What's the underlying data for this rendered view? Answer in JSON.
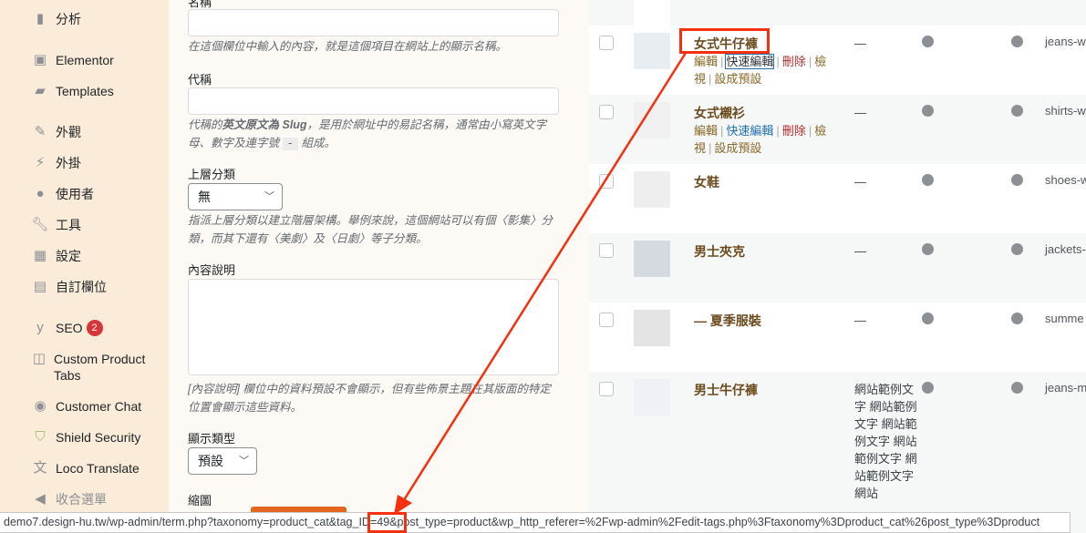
{
  "sidebar": {
    "items": [
      {
        "label": "分析",
        "icon": "chart-bar-icon"
      },
      {
        "label": "Elementor",
        "icon": "elementor-icon"
      },
      {
        "label": "Templates",
        "icon": "folder-icon"
      },
      {
        "label": "外觀",
        "icon": "paintbrush-icon"
      },
      {
        "label": "外掛",
        "icon": "plugin-icon"
      },
      {
        "label": "使用者",
        "icon": "user-icon"
      },
      {
        "label": "工具",
        "icon": "wrench-icon"
      },
      {
        "label": "設定",
        "icon": "settings-icon"
      },
      {
        "label": "自訂欄位",
        "icon": "grid-icon"
      },
      {
        "label": "SEO",
        "icon": "yoast-icon",
        "badge": "2"
      },
      {
        "label": "Custom Product Tabs",
        "icon": "tabs-icon"
      },
      {
        "label": "Customer Chat",
        "icon": "messenger-icon"
      },
      {
        "label": "Shield Security",
        "icon": "shield-icon"
      },
      {
        "label": "Loco Translate",
        "icon": "translate-icon"
      },
      {
        "label": "收合選單",
        "icon": "collapse-icon"
      }
    ]
  },
  "form": {
    "name_label": "名稱",
    "name_help": "在這個欄位中輸入的內容，就是這個項目在網站上的顯示名稱。",
    "slug_label": "代稱",
    "slug_help_a": "代稱的",
    "slug_help_b": "英文原文為 Slug",
    "slug_help_c": "，是用於網址中的易記名稱，通常由小寫英文字母、數字及連字號",
    "slug_help_code": "-",
    "slug_help_d": "組成。",
    "parent_label": "上層分類",
    "parent_value": "無",
    "parent_help": "指派上層分類以建立階層架構。舉例來說，這個網站可以有個〈影集〉分類，而其下還有〈美劇〉及〈日劇〉等子分類。",
    "desc_label": "內容說明",
    "desc_help": "[內容說明] 欄位中的資料預設不會顯示，但有些佈景主題在其版面的特定位置會顯示這些資料。",
    "display_label": "顯示類型",
    "display_value": "預設",
    "thumb_label": "縮圖"
  },
  "row_actions": {
    "edit": "編輯",
    "quick_edit": "快速編輯",
    "delete": "刪除",
    "view": "檢視",
    "set_default": "設成預設"
  },
  "rows": [
    {
      "name": "女式牛仔褲",
      "desc": "—",
      "slug": "jeans-w"
    },
    {
      "name": "女式襯衫",
      "desc": "—",
      "slug": "shirts-w"
    },
    {
      "name": "女鞋",
      "desc": "—",
      "slug": "shoes-w"
    },
    {
      "name": "男士夾克",
      "desc": "—",
      "slug": "jackets-"
    },
    {
      "name": "— 夏季服裝",
      "desc": "—",
      "slug": "summe"
    },
    {
      "name": "男士牛仔褲",
      "desc": "網站範例文字 網站範例文字 網站範例文字 網站範例文字 網站範例文字 網站",
      "slug": "jeans-m"
    }
  ],
  "status_url": "demo7.design-hu.tw/wp-admin/term.php?taxonomy=product_cat&tag_ID=49&post_type=product&wp_http_referer=%2Fwp-admin%2Fedit-tags.php%3Ftaxonomy%3Dproduct_cat%26post_type%3Dproduct",
  "colors": {
    "sidebar_bg": "#fbecd9",
    "annotation": "#f5300f",
    "link": "#8a6a2a",
    "delete": "#b32d2e",
    "button": "#e2661f"
  }
}
